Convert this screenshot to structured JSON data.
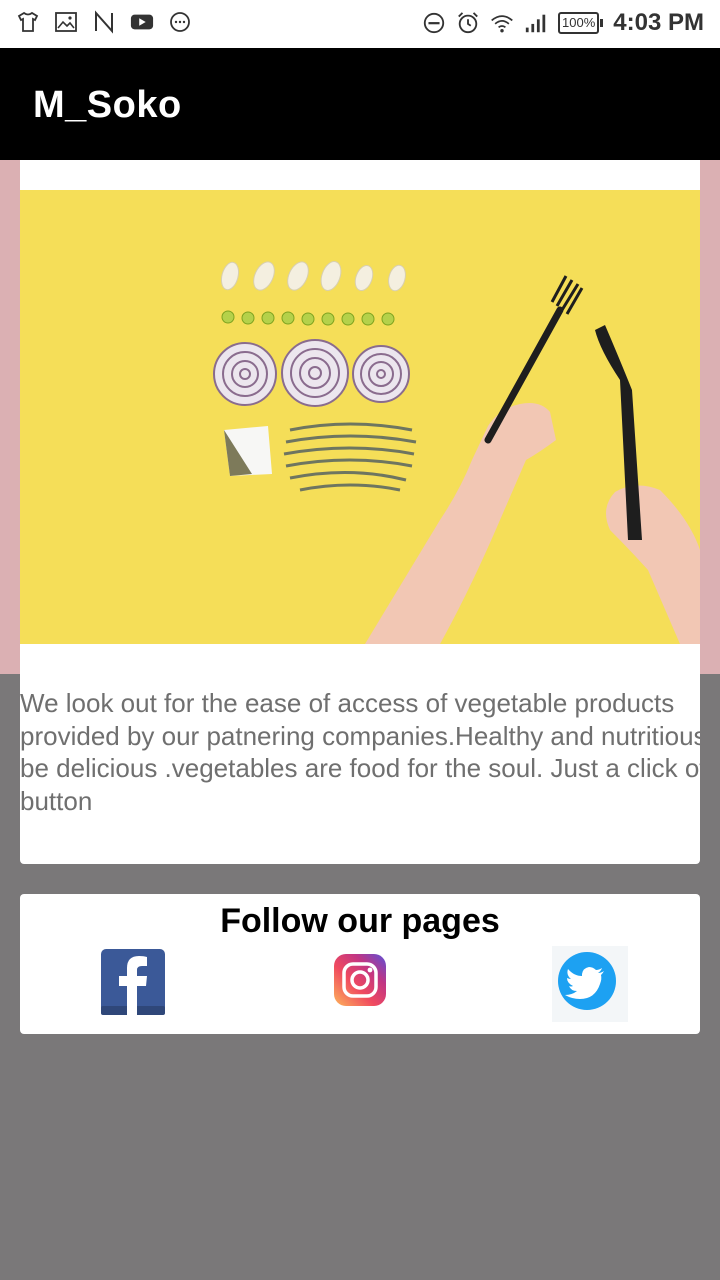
{
  "status_bar": {
    "left_icons": [
      "tshirt-icon",
      "image-icon",
      "n-icon",
      "youtube-icon",
      "chat-icon"
    ],
    "right_icons": [
      "dnd-icon",
      "alarm-icon",
      "wifi-icon",
      "signal-icon",
      "battery-icon"
    ],
    "battery": "100%",
    "time": "4:03 PM"
  },
  "app_bar": {
    "title": "M_Soko"
  },
  "hero": {
    "image": "food-flatlay-image"
  },
  "description": {
    "text": "We look out for the ease of access of vegetable products provided by our patnering companies.Healthy and nutritious can be delicious .vegetables are food for the soul. Just a click of a button"
  },
  "follow": {
    "title": "Follow our pages",
    "links": [
      {
        "icon": "facebook-icon",
        "color": "#3b5998"
      },
      {
        "icon": "instagram-icon",
        "color": "#e1306c"
      },
      {
        "icon": "twitter-icon",
        "color": "#1da1f2"
      }
    ]
  },
  "colors": {
    "app_bar": "#000000",
    "hero_band": "#dbb0b3",
    "background": "#7a7879",
    "hero_yellow": "#f5de58"
  }
}
